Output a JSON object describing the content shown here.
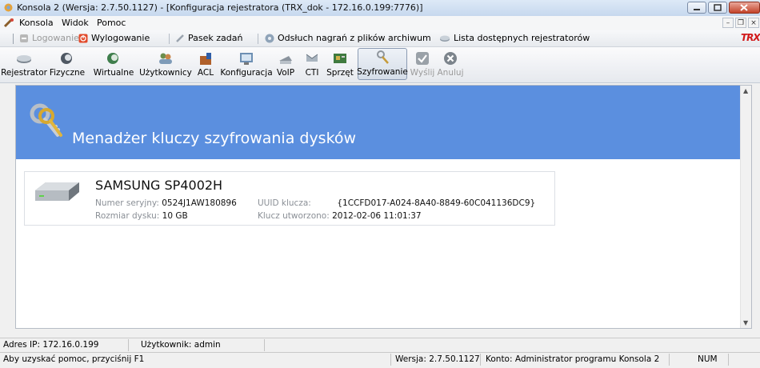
{
  "window": {
    "title": "Konsola 2 (Wersja:  2.7.50.1127) - [Konfiguracja rejestratora (TRX_dok - 172.16.0.199:7776)]"
  },
  "menu": {
    "items": [
      "Konsola",
      "Widok",
      "Pomoc"
    ]
  },
  "quickbar": {
    "login": "Logowanie",
    "logout": "Wylogowanie",
    "taskbar": "Pasek zadań",
    "playback": "Odsłuch nagrań z plików archiwum",
    "recorders": "Lista dostępnych rejestratorów",
    "brand": "TRX"
  },
  "toolbar": {
    "items": [
      {
        "label": "Rejestrator",
        "icon": "recorder-icon"
      },
      {
        "label": "Fizyczne",
        "icon": "physical-channels-icon"
      },
      {
        "label": "Wirtualne",
        "icon": "virtual-channels-icon"
      },
      {
        "label": "Użytkownicy",
        "icon": "users-icon"
      },
      {
        "label": "ACL",
        "icon": "acl-icon"
      },
      {
        "label": "Konfiguracja",
        "icon": "configuration-icon"
      },
      {
        "label": "VoIP",
        "icon": "voip-icon"
      },
      {
        "label": "CTI",
        "icon": "cti-icon"
      },
      {
        "label": "Sprzęt",
        "icon": "hardware-icon"
      },
      {
        "label": "Szyfrowanie",
        "icon": "encryption-keys-icon",
        "active": true
      },
      {
        "label": "Wyślij",
        "icon": "send-icon",
        "disabled": true
      },
      {
        "label": "Anuluj",
        "icon": "cancel-icon",
        "disabled": true
      }
    ]
  },
  "panel": {
    "heading": "Menadżer kluczy szyfrowania dysków",
    "banner_color": "#5b8fdf"
  },
  "disk": {
    "model": "SAMSUNG SP4002H",
    "serial_label": "Numer seryjny:",
    "serial_value": "0524J1AW180896",
    "size_label": "Rozmiar dysku:",
    "size_value": "10 GB",
    "uuid_label": "UUID klucza:",
    "uuid_value": "{1CCFD017-A024-8A40-8849-60C041136DC9}",
    "created_label": "Klucz utworzono:",
    "created_value": "2012-02-06 11:01:37"
  },
  "status": {
    "ip": "Adres IP: 172.16.0.199",
    "user": "Użytkownik: admin",
    "help": "Aby uzyskać pomoc, przyciśnij F1",
    "version": "Wersja: 2.7.50.1127",
    "account": "Konto: Administrator programu Konsola 2",
    "num": "NUM"
  }
}
